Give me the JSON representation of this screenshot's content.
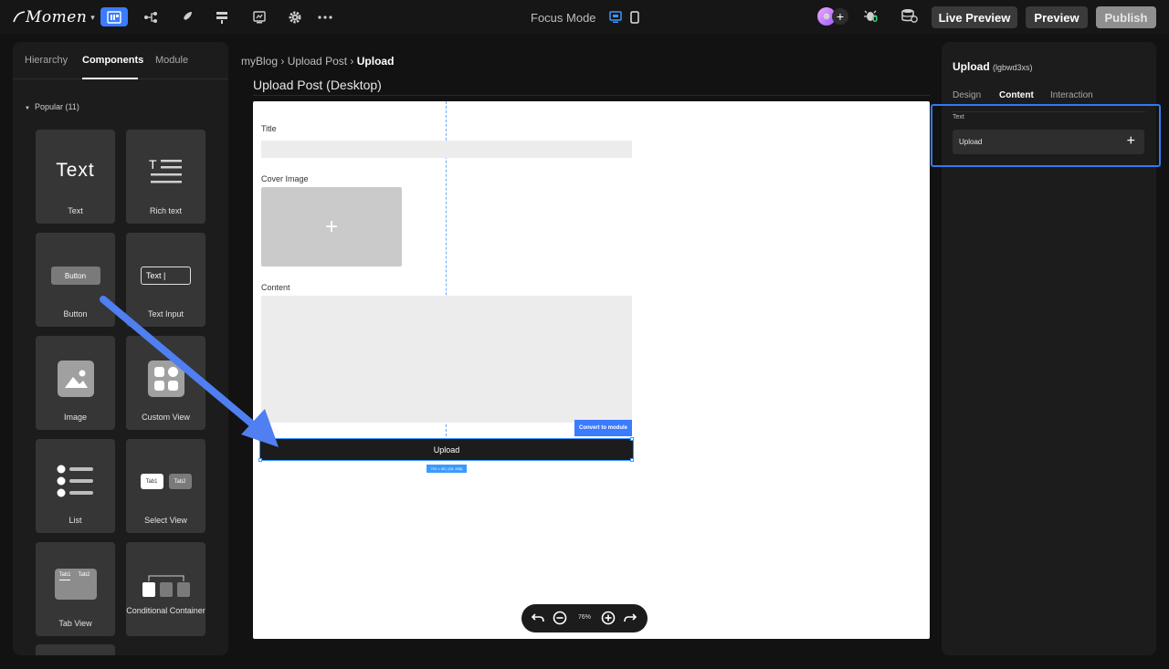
{
  "topbar": {
    "logo": "Momen",
    "focus_mode": "Focus Mode",
    "bug_count": "0",
    "live_preview": "Live Preview",
    "preview": "Preview",
    "publish": "Publish",
    "icons": [
      "page-view-icon",
      "hierarchy-icon",
      "rocket-icon",
      "database-icon",
      "preview-window-icon",
      "settings-icon",
      "more-icon"
    ]
  },
  "left_panel": {
    "tabs": [
      "Hierarchy",
      "Components",
      "Module"
    ],
    "section": "Popular (11)",
    "components": [
      {
        "label": "Text",
        "preview": "Text"
      },
      {
        "label": "Rich text",
        "preview": "T"
      },
      {
        "label": "Button",
        "preview": "Button"
      },
      {
        "label": "Text Input",
        "preview": "Text |"
      },
      {
        "label": "Image",
        "preview": ""
      },
      {
        "label": "Custom View",
        "preview": ""
      },
      {
        "label": "List",
        "preview": ""
      },
      {
        "label": "Select View",
        "preview_tab1": "Tab1",
        "preview_tab2": "Tab2"
      },
      {
        "label": "Tab View",
        "preview_tab1": "Tab1",
        "preview_tab2": "Tab2"
      },
      {
        "label": "Conditional Container",
        "preview": ""
      }
    ]
  },
  "center": {
    "breadcrumb": [
      "myBlog",
      "Upload Post",
      "Upload"
    ],
    "page_title": "Upload Post (Desktop)",
    "fields": {
      "title": "Title",
      "cover_image": "Cover Image",
      "content": "Content"
    },
    "convert_label": "Convert to module",
    "upload_button": "Upload",
    "dims": "701 × 40 | (15, 635)",
    "zoom": "76%"
  },
  "right_panel": {
    "title": "Upload",
    "id": "(lgbwd3xs)",
    "tabs": [
      "Design",
      "Content",
      "Interaction"
    ],
    "text_label": "Text",
    "text_value": "Upload"
  },
  "colors": {
    "accent": "#3a7bff",
    "highlight": "#2f7bf5",
    "arrow": "#4f7ff0"
  }
}
